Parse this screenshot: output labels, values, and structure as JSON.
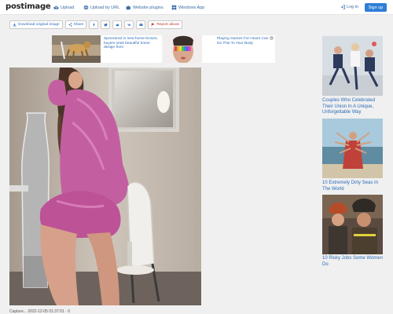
{
  "header": {
    "logo_prefix": "post",
    "logo_suffix": "image",
    "nav": [
      {
        "label": "Upload",
        "icon": "cloud-upload-icon"
      },
      {
        "label": "Upload by URL",
        "icon": "globe-icon"
      },
      {
        "label": "Website plugins",
        "icon": "puzzle-icon"
      },
      {
        "label": "Windows App",
        "icon": "windows-icon"
      }
    ],
    "login_label": "Log in",
    "signup_label": "Sign up"
  },
  "toolbar": {
    "download_label": "Download original image",
    "share_label": "Share",
    "social_icons": [
      "facebook-icon",
      "twitter-icon",
      "reddit-icon",
      "vk-icon",
      "email-icon"
    ],
    "report_label": "Report abuse"
  },
  "ads": [
    {
      "text": "Sponsored in new-home lecture, buyers seek beautiful home design from"
    },
    {
      "text": "Playing Games For Hours Can Do This To Your Body"
    }
  ],
  "sidebar": [
    {
      "caption": "Couples Who Celebrated Their Union In A Unique, Unforgettable Way"
    },
    {
      "caption": "10 Extremely Dirty Seas In The World"
    },
    {
      "caption": "10 Risky Jobs Some Women Do"
    }
  ],
  "caption": "Capture... 2022-12-05 01:37:01 · 0",
  "colors": {
    "accent": "#2e7ed6",
    "link": "#2a6bb8",
    "report": "#c0392b"
  }
}
